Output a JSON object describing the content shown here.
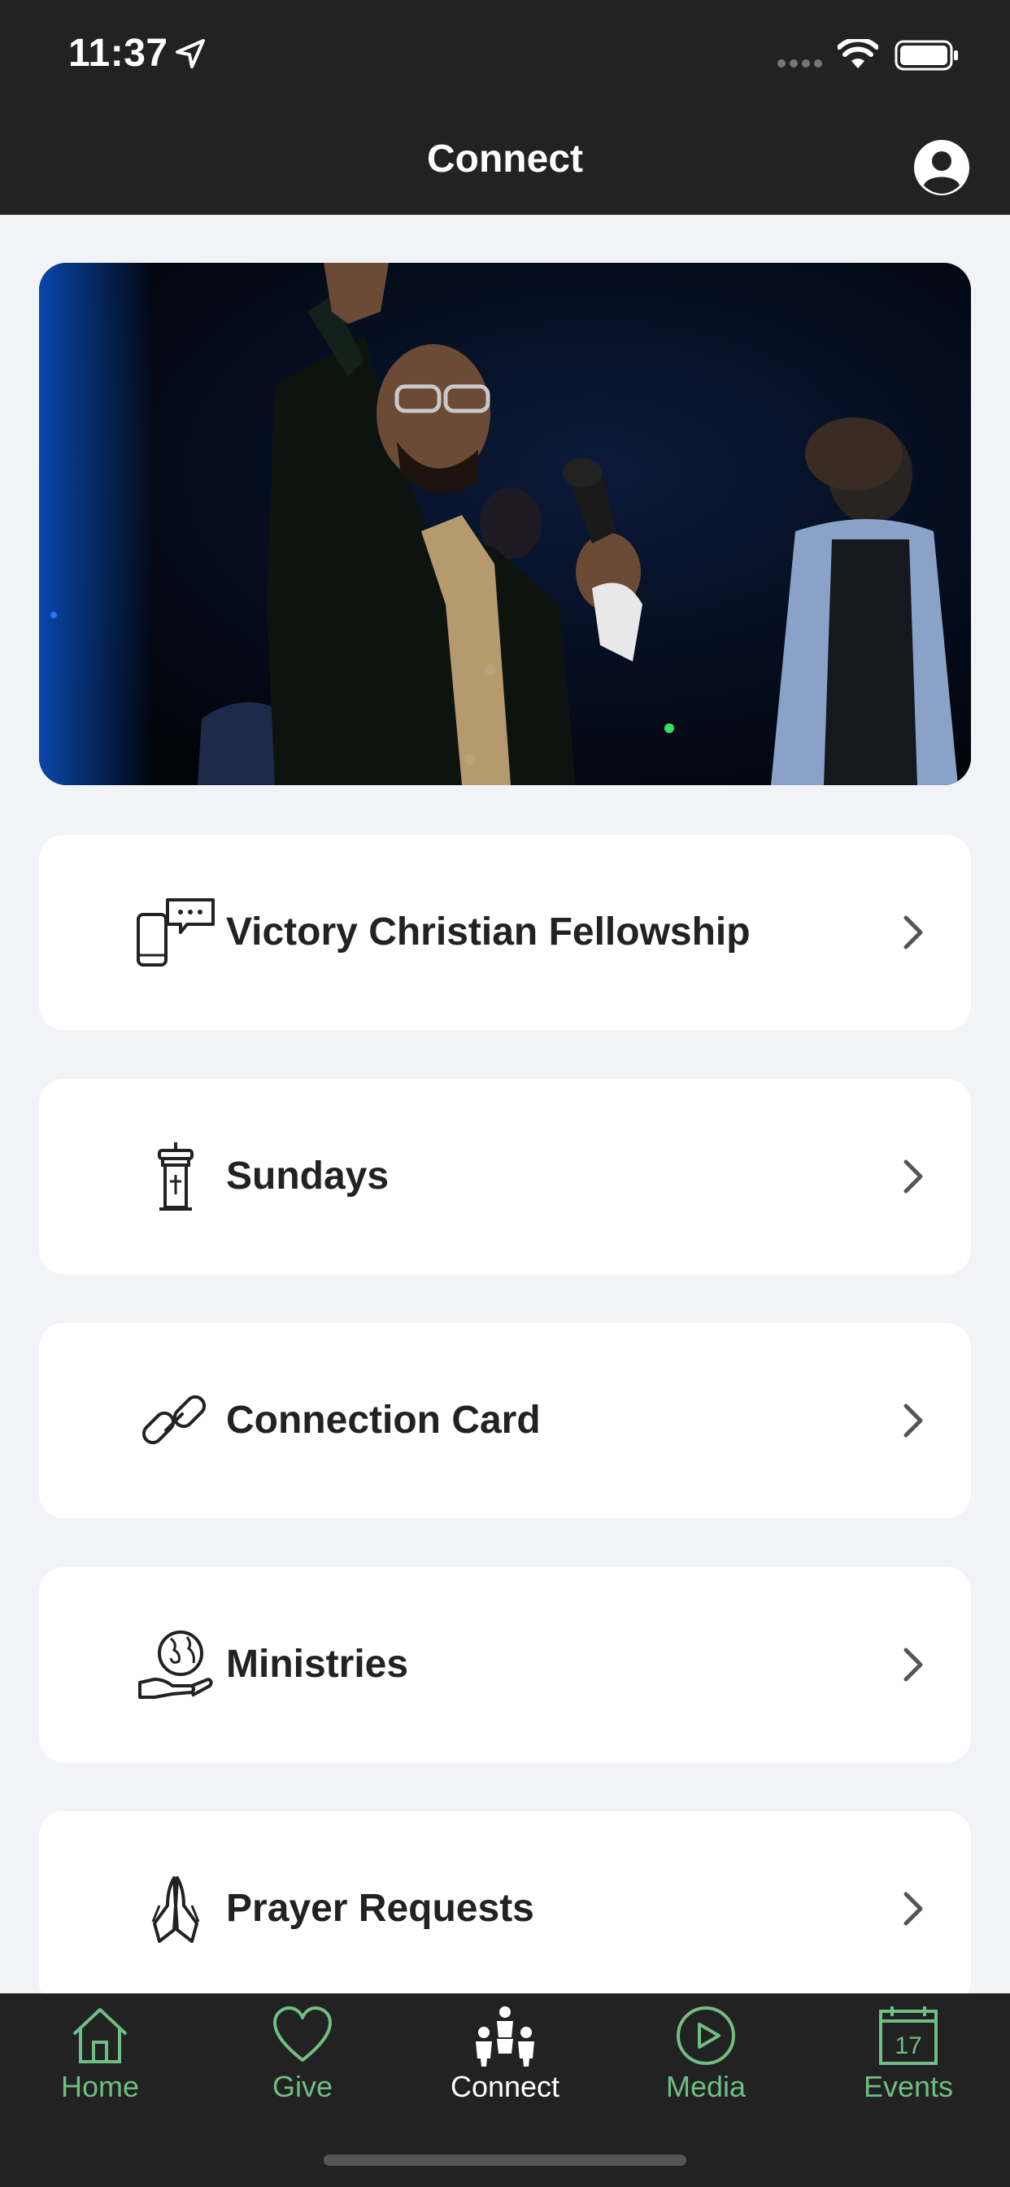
{
  "status_bar": {
    "time": "11:37"
  },
  "nav": {
    "title": "Connect"
  },
  "hero": {
    "image": "preacher-on-stage-photo"
  },
  "items": [
    {
      "label": "Victory Christian Fellowship",
      "icon": "phone-chat-icon"
    },
    {
      "label": "Sundays",
      "icon": "pulpit-icon"
    },
    {
      "label": "Connection Card",
      "icon": "link-icon"
    },
    {
      "label": "Ministries",
      "icon": "globe-hand-icon"
    },
    {
      "label": "Prayer Requests",
      "icon": "praying-hands-icon"
    }
  ],
  "tabs": [
    {
      "label": "Home",
      "icon": "home-icon"
    },
    {
      "label": "Give",
      "icon": "heart-icon"
    },
    {
      "label": "Connect",
      "icon": "people-icon"
    },
    {
      "label": "Media",
      "icon": "play-icon"
    },
    {
      "label": "Events",
      "icon": "calendar-icon",
      "badge": "17"
    }
  ],
  "colors": {
    "header_bg": "#222222",
    "page_bg": "#f2f3f7",
    "accent_green": "#6fbe82",
    "text_dark": "#222222"
  }
}
